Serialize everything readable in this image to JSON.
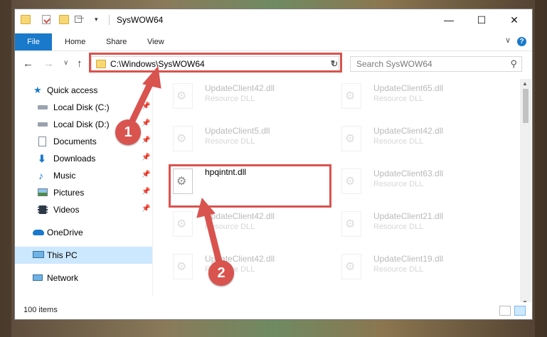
{
  "window": {
    "title": "SysWOW64",
    "minimize_glyph": "—",
    "maximize_glyph": "☐",
    "close_glyph": "✕"
  },
  "ribbon": {
    "tabs": [
      "File",
      "Home",
      "Share",
      "View"
    ],
    "collapse_glyph": "∨",
    "help_glyph": "?"
  },
  "navigation": {
    "back_glyph": "←",
    "forward_glyph": "→",
    "recent_glyph": "∨",
    "up_glyph": "↑",
    "address_path": "C:\\Windows\\SysWOW64",
    "address_dropdown_glyph": "∨",
    "refresh_glyph": "↻",
    "search_placeholder": "Search SysWOW64",
    "search_glyph": "⚲"
  },
  "sidebar": {
    "items": [
      {
        "label": "Quick access",
        "icon": "star-icon",
        "pinned": false
      },
      {
        "label": "Local Disk (C:)",
        "icon": "drive-icon",
        "pinned": true
      },
      {
        "label": "Local Disk (D:)",
        "icon": "drive-icon",
        "pinned": true
      },
      {
        "label": "Documents",
        "icon": "documents-icon",
        "pinned": true
      },
      {
        "label": "Downloads",
        "icon": "download-icon",
        "pinned": true
      },
      {
        "label": "Music",
        "icon": "music-icon",
        "pinned": true
      },
      {
        "label": "Pictures",
        "icon": "pictures-icon",
        "pinned": true
      },
      {
        "label": "Videos",
        "icon": "videos-icon",
        "pinned": true
      },
      {
        "label": "OneDrive",
        "icon": "cloud-icon",
        "pinned": false
      },
      {
        "label": "This PC",
        "icon": "computer-icon",
        "pinned": false,
        "selected": true
      },
      {
        "label": "Network",
        "icon": "network-icon",
        "pinned": false
      }
    ],
    "pin_glyph": "📌"
  },
  "files": {
    "left_column": [
      {
        "name": "UpdateClient42.dll",
        "type": "Resource DLL",
        "faded": true
      },
      {
        "name": "UpdateClient5.dll",
        "type": "Resource DLL",
        "faded": true
      },
      {
        "name": "hpqintnt.dll",
        "type": "",
        "faded": false
      },
      {
        "name": "UpdateClient42.dll",
        "type": "Resource DLL",
        "faded": true
      },
      {
        "name": "UpdateClient42.dll",
        "type": "Resource DLL",
        "faded": true
      }
    ],
    "right_column": [
      {
        "name": "UpdateClient65.dll",
        "type": "Resource DLL",
        "faded": true
      },
      {
        "name": "UpdateClient42.dll",
        "type": "Resource DLL",
        "faded": true
      },
      {
        "name": "UpdateClient63.dll",
        "type": "Resource DLL",
        "faded": true
      },
      {
        "name": "UpdateClient21.dll",
        "type": "Resource DLL",
        "faded": true
      },
      {
        "name": "UpdateClient19.dll",
        "type": "Resource DLL",
        "faded": true
      }
    ],
    "gear_glyph": "⚙"
  },
  "status": {
    "item_count": "100 items"
  },
  "annotations": {
    "step1": "1",
    "step2": "2",
    "color": "#d9534f"
  },
  "colors": {
    "accent": "#1979ca",
    "selected_bg": "#cce8ff",
    "folder": "#f8d775"
  }
}
